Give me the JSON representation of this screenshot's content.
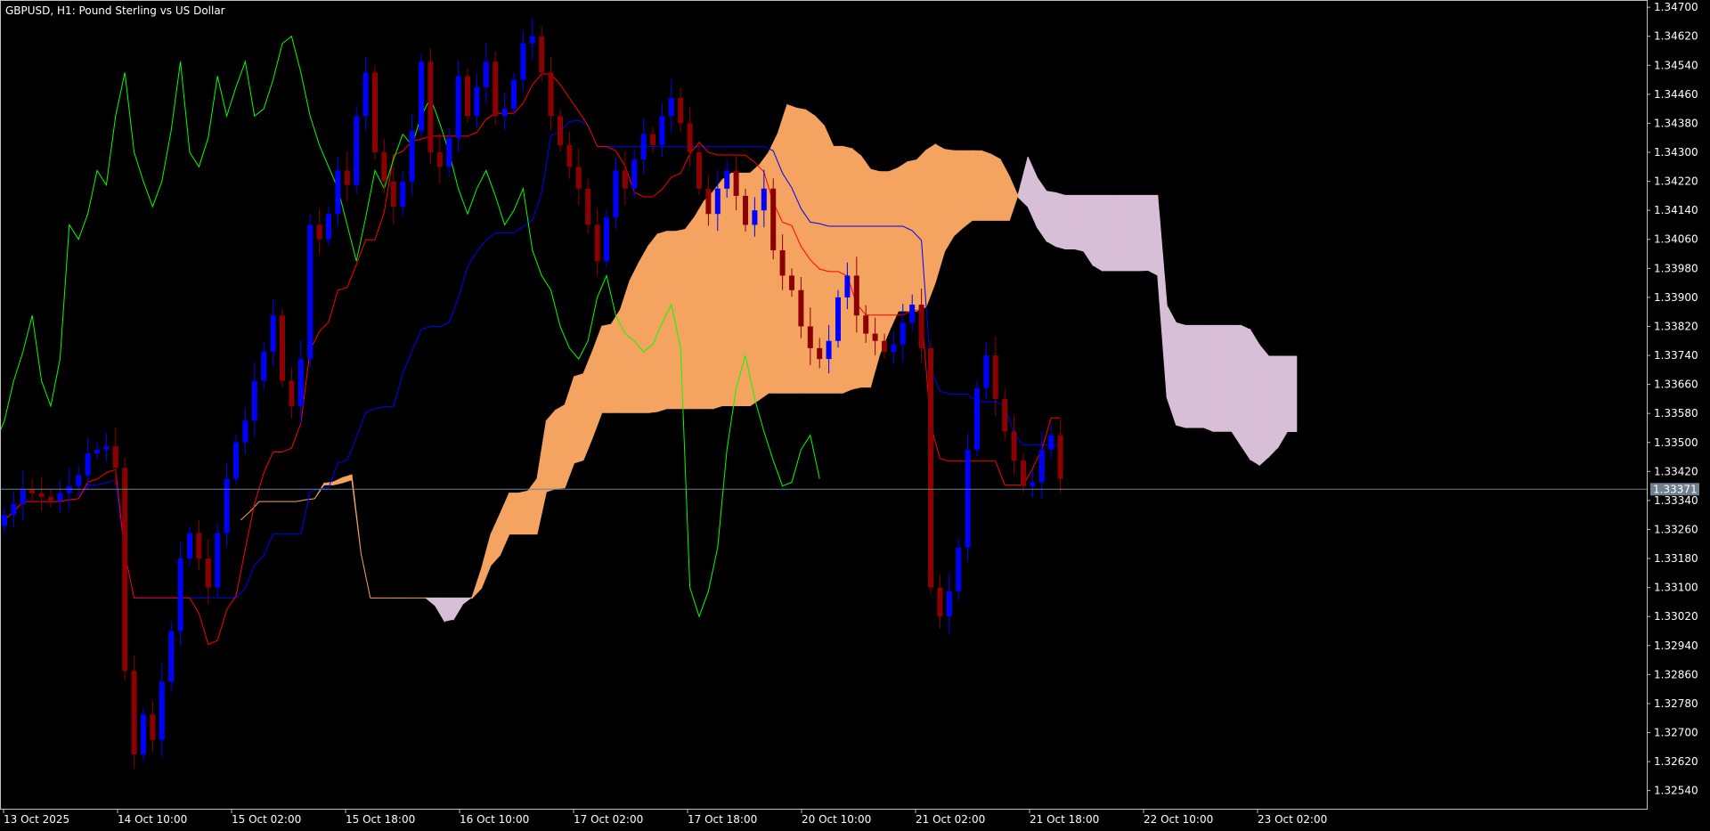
{
  "title": "GBPUSD, H1:  Pound Sterling vs US Dollar",
  "current_price": "1.33371",
  "colors": {
    "background": "#000000",
    "frame": "#c0c0c0",
    "bull_candle": "#0000ff",
    "bear_candle": "#8b0000",
    "tenkan": "#ff0000",
    "kijun": "#0000ff",
    "chikou": "#00ff00",
    "kumo_bull": "#f4a460",
    "kumo_bear": "#d8bfd8",
    "price_line": "#708090",
    "price_tag_bg": "#708090"
  },
  "chart_data": {
    "type": "candlestick",
    "symbol": "GBPUSD",
    "timeframe": "H1",
    "ylim": [
      1.3249,
      1.3472
    ],
    "y_ticks": [
      "1.34700",
      "1.34620",
      "1.34540",
      "1.34460",
      "1.34380",
      "1.34300",
      "1.34220",
      "1.34140",
      "1.34060",
      "1.33980",
      "1.33900",
      "1.33820",
      "1.33740",
      "1.33660",
      "1.33580",
      "1.33500",
      "1.33420",
      "1.33340",
      "1.33260",
      "1.33180",
      "1.33100",
      "1.33020",
      "1.32940",
      "1.32860",
      "1.32780",
      "1.32700",
      "1.32620",
      "1.32540"
    ],
    "x_ticks": [
      "13 Oct 2025",
      "14 Oct 10:00",
      "15 Oct 02:00",
      "15 Oct 18:00",
      "16 Oct 10:00",
      "17 Oct 02:00",
      "17 Oct 18:00",
      "20 Oct 10:00",
      "21 Oct 02:00",
      "21 Oct 18:00",
      "22 Oct 10:00",
      "23 Oct 02:00"
    ],
    "close": [
      1.333,
      1.3333,
      1.3337,
      1.3336,
      1.3335,
      1.3334,
      1.3336,
      1.3338,
      1.3341,
      1.3347,
      1.3348,
      1.3349,
      1.3343,
      1.3287,
      1.3264,
      1.3275,
      1.3268,
      1.3284,
      1.3298,
      1.3318,
      1.3325,
      1.3318,
      1.331,
      1.3325,
      1.334,
      1.335,
      1.3356,
      1.3367,
      1.3375,
      1.3385,
      1.3367,
      1.336,
      1.3373,
      1.341,
      1.3406,
      1.3413,
      1.3425,
      1.3421,
      1.344,
      1.3452,
      1.343,
      1.3422,
      1.3415,
      1.3422,
      1.3436,
      1.3455,
      1.343,
      1.3426,
      1.3434,
      1.3451,
      1.344,
      1.3448,
      1.3455,
      1.344,
      1.3442,
      1.345,
      1.346,
      1.3462,
      1.3452,
      1.344,
      1.3432,
      1.3426,
      1.342,
      1.341,
      1.34,
      1.3412,
      1.3425,
      1.342,
      1.3428,
      1.3435,
      1.3432,
      1.344,
      1.3445,
      1.3438,
      1.343,
      1.342,
      1.3413,
      1.342,
      1.3425,
      1.3418,
      1.341,
      1.3414,
      1.342,
      1.3403,
      1.3396,
      1.3392,
      1.3382,
      1.3376,
      1.3373,
      1.3378,
      1.339,
      1.3396,
      1.3385,
      1.338,
      1.3378,
      1.3375,
      1.3377,
      1.3383,
      1.3388,
      1.3376,
      1.331,
      1.3302,
      1.3309,
      1.3321,
      1.3348,
      1.3365,
      1.3374,
      1.3362,
      1.3353,
      1.3345,
      1.3338,
      1.3339,
      1.3348,
      1.3352,
      1.334
    ]
  }
}
